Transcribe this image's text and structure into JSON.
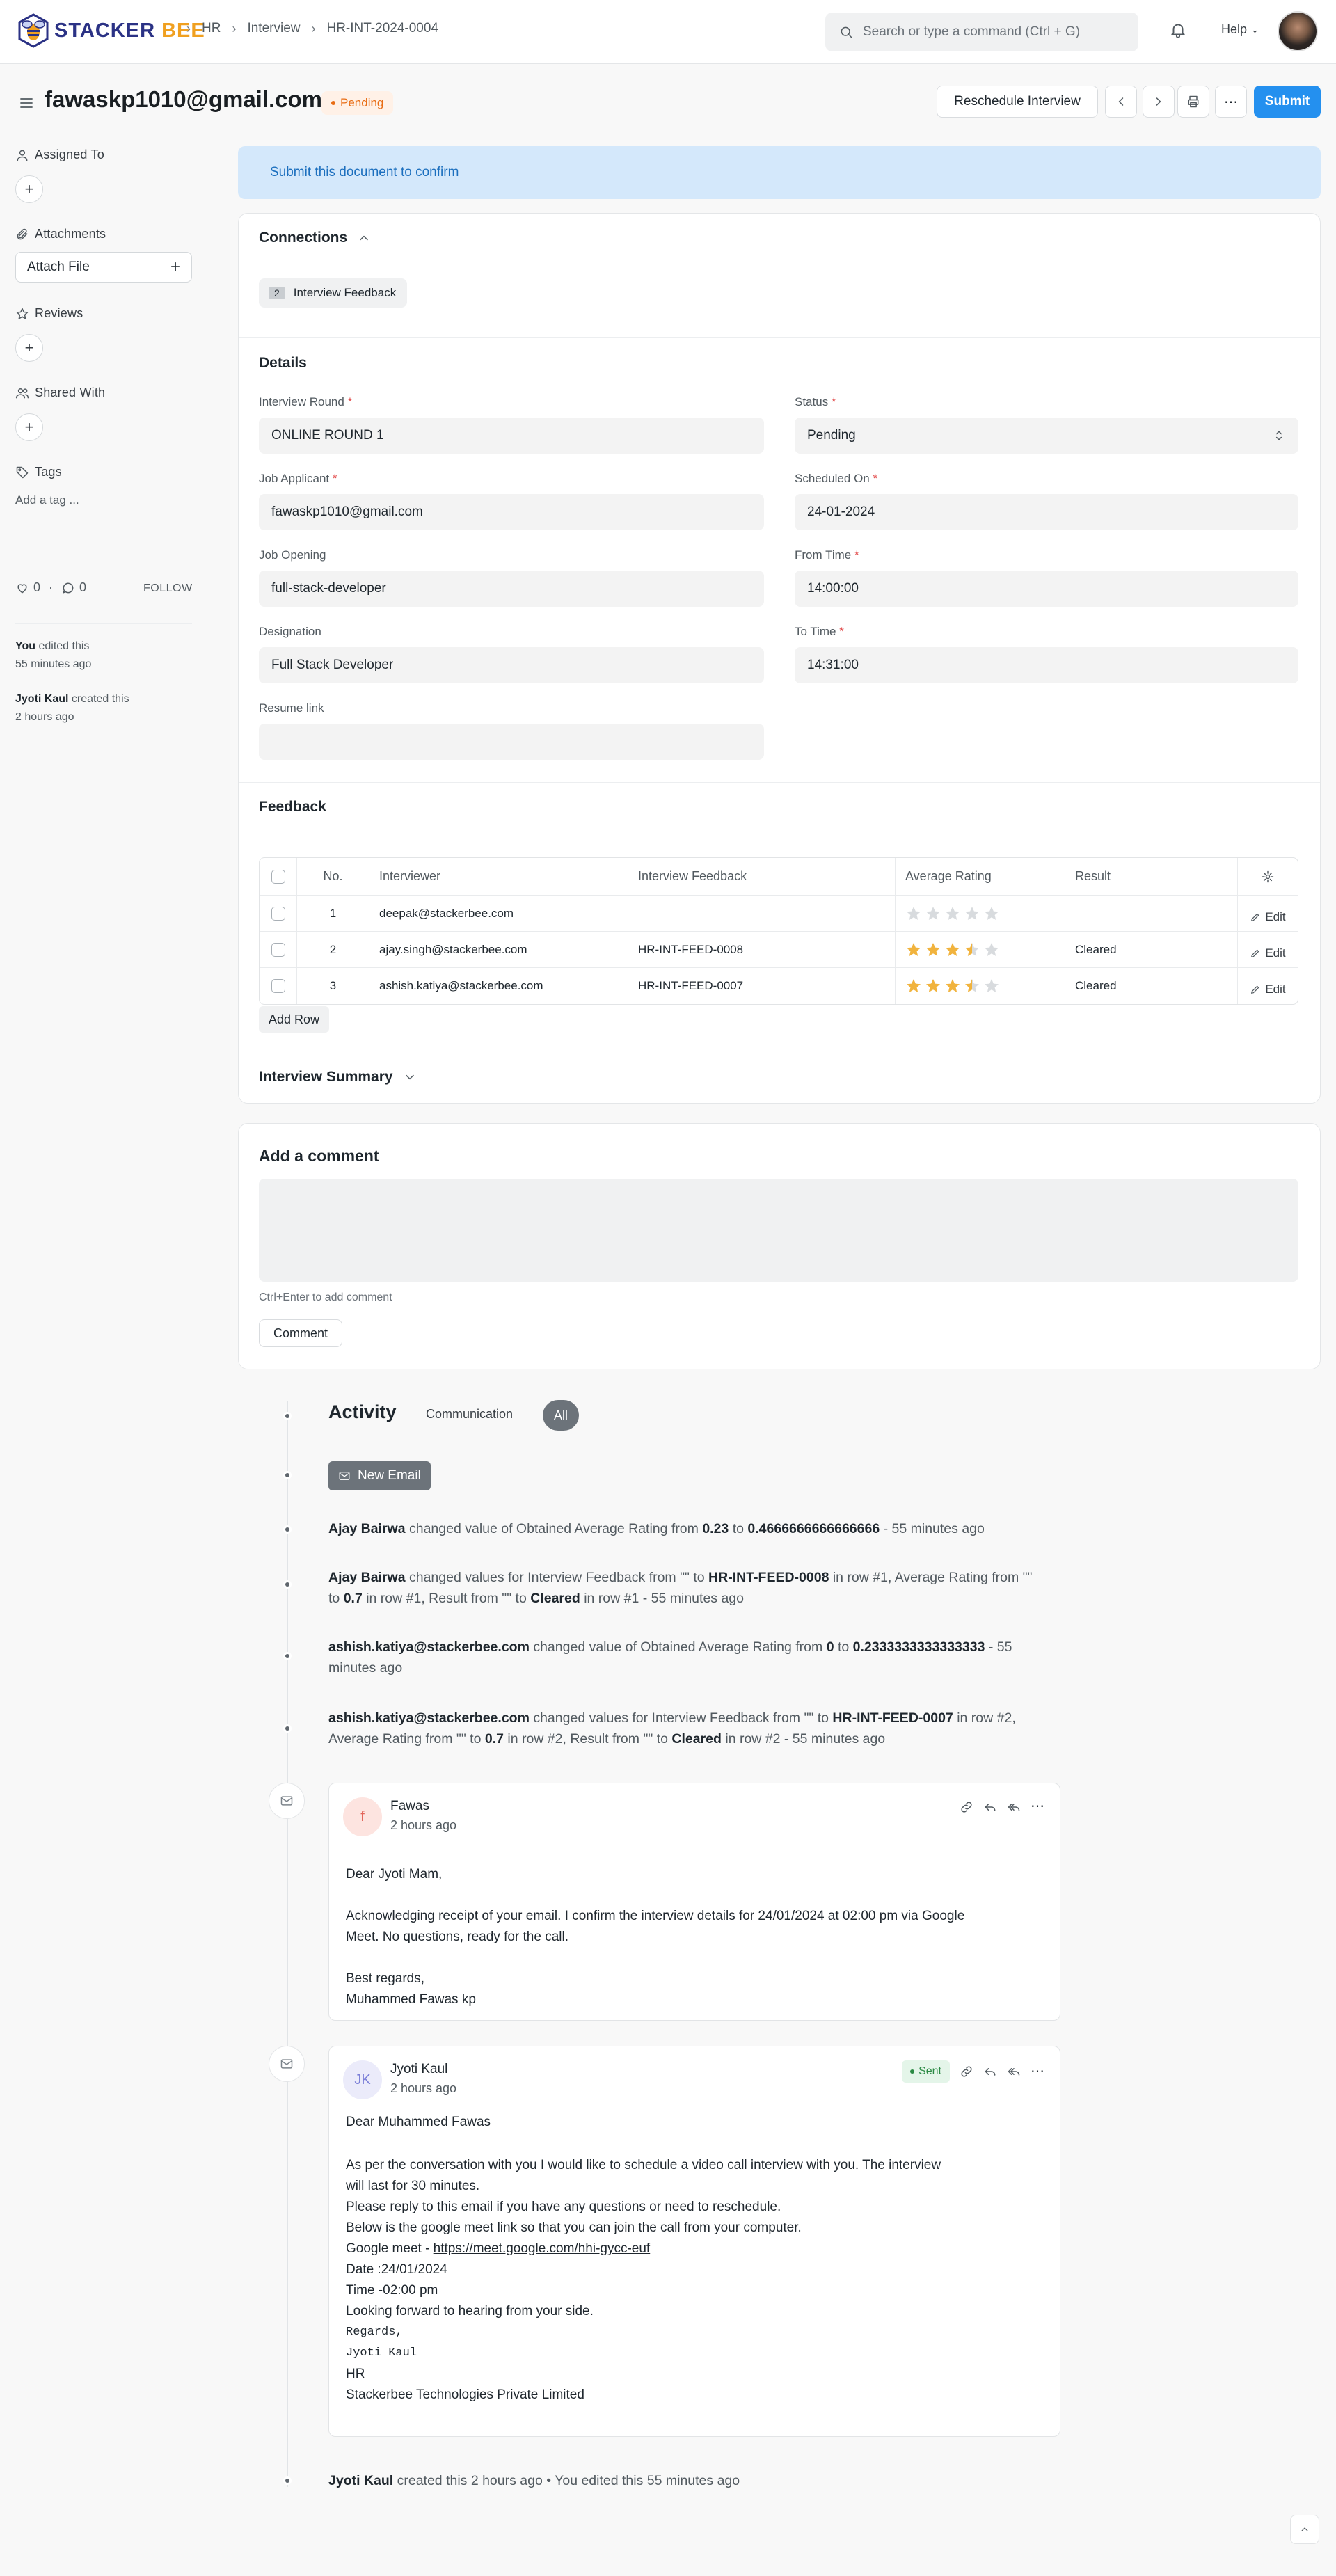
{
  "navbar": {
    "logo_text_1": "STACKER",
    "logo_text_2": "BEE",
    "breadcrumbs": [
      "HR",
      "Interview",
      "HR-INT-2024-0004"
    ],
    "search_placeholder": "Search or type a command (Ctrl + G)",
    "help_label": "Help"
  },
  "page": {
    "title": "fawaskp1010@gmail.com",
    "status_badge": "Pending",
    "reschedule_label": "Reschedule Interview",
    "submit_label": "Submit"
  },
  "sidebar": {
    "assigned_to": "Assigned To",
    "attachments": "Attachments",
    "attach_file": "Attach File",
    "reviews": "Reviews",
    "shared_with": "Shared With",
    "tags": "Tags",
    "add_tag": "Add a tag ...",
    "likes": "0",
    "comments": "0",
    "follow": "FOLLOW",
    "log": [
      {
        "who": "You",
        "text": " edited this",
        "when": "55 minutes ago"
      },
      {
        "who": "Jyoti Kaul",
        "text": " created this",
        "when": "2 hours ago"
      }
    ]
  },
  "banner": "Submit this document to confirm",
  "connections": {
    "title": "Connections",
    "count": "2",
    "label": "Interview Feedback"
  },
  "details": {
    "title": "Details",
    "interview_round_label": "Interview Round",
    "interview_round": "ONLINE ROUND 1",
    "job_applicant_label": "Job Applicant",
    "job_applicant": "fawaskp1010@gmail.com",
    "job_opening_label": "Job Opening",
    "job_opening": "full-stack-developer",
    "designation_label": "Designation",
    "designation": "Full Stack Developer",
    "resume_link_label": "Resume link",
    "resume_link": "",
    "status_label": "Status",
    "status": "Pending",
    "scheduled_on_label": "Scheduled On",
    "scheduled_on": "24-01-2024",
    "from_time_label": "From Time",
    "from_time": "14:00:00",
    "to_time_label": "To Time",
    "to_time": "14:31:00"
  },
  "feedback": {
    "title": "Feedback",
    "columns": [
      "No.",
      "Interviewer",
      "Interview Feedback",
      "Average Rating",
      "Result"
    ],
    "rows": [
      {
        "no": "1",
        "interviewer": "deepak@stackerbee.com",
        "feedback": "",
        "rating": 0,
        "result": ""
      },
      {
        "no": "2",
        "interviewer": "ajay.singh@stackerbee.com",
        "feedback": "HR-INT-FEED-0008",
        "rating": 3.5,
        "result": "Cleared"
      },
      {
        "no": "3",
        "interviewer": "ashish.katiya@stackerbee.com",
        "feedback": "HR-INT-FEED-0007",
        "rating": 3.5,
        "result": "Cleared"
      }
    ],
    "edit_label": "Edit",
    "add_row": "Add Row"
  },
  "summary_title": "Interview Summary",
  "comment": {
    "title": "Add a comment",
    "hint": "Ctrl+Enter to add comment",
    "button": "Comment"
  },
  "activity": {
    "title": "Activity",
    "tab_communication": "Communication",
    "tab_all": "All",
    "new_email": "New Email",
    "items": [
      {
        "actor": "Ajay Bairwa",
        "t1": " changed value of Obtained Average Rating from ",
        "v1": "0.23",
        "t2": " to ",
        "v2": "0.4666666666666666",
        "t3": " - 55 minutes ago"
      },
      {
        "actor": "Ajay Bairwa",
        "t1": " changed values for Interview Feedback from \"\" to ",
        "v1": "HR-INT-FEED-0008",
        "t2": " in row #1, Average Rating from \"\" to ",
        "v2": "0.7",
        "t3": " in row #1, Result from \"\" to ",
        "v3": "Cleared",
        "t4": " in row #1 - 55 minutes ago"
      },
      {
        "actor": "ashish.katiya@stackerbee.com",
        "t1": " changed value of Obtained Average Rating from ",
        "v1": "0",
        "t2": " to ",
        "v2": "0.2333333333333333",
        "t3": " - 55 minutes ago"
      },
      {
        "actor": "ashish.katiya@stackerbee.com",
        "t1": " changed values for Interview Feedback from \"\" to ",
        "v1": "HR-INT-FEED-0007",
        "t2": " in row #2, Average Rating from \"\" to ",
        "v2": "0.7",
        "t3": " in row #2, Result from \"\" to ",
        "v3": "Cleared",
        "t4": " in row #2 - 55 minutes ago"
      }
    ],
    "footer_actor": "Jyoti Kaul",
    "footer_text": " created this 2 hours ago • You edited this 55 minutes ago"
  },
  "email1": {
    "initial": "f",
    "sender": "Fawas",
    "time": "2 hours ago",
    "lines": [
      "Dear Jyoti Mam,",
      "",
      "Acknowledging receipt of your email. I confirm the interview details for 24/01/2024 at 02:00 pm via Google",
      "Meet. No questions, ready for the call.",
      "",
      "Best regards,",
      "Muhammed Fawas kp"
    ]
  },
  "email2": {
    "initial": "JK",
    "sender": "Jyoti Kaul",
    "time": "2 hours ago",
    "sent_badge": "Sent",
    "greeting": "Dear Muhammed Fawas",
    "lines": [
      "As per the conversation with you I would like to schedule a video call interview with you. The interview",
      "will last for 30 minutes.",
      "Please reply to this email if you have any questions or need to reschedule.",
      "Below is the google meet link so that you can join the call from your computer."
    ],
    "meet_prefix": "Google meet - ",
    "meet_link": "https://meet.google.com/hhi-gycc-euf",
    "date_line": "Date :24/01/2024",
    "time_line": "Time -02:00 pm",
    "closing": "Looking forward to hearing from your side.",
    "sig1": "Regards,",
    "sig2": "Jyoti Kaul",
    "sig3": "HR",
    "sig4": "Stackerbee Technologies Private Limited"
  },
  "colors": {
    "primary": "#2490ef",
    "pending": "#e86c13",
    "star": "#f1b33d",
    "star_empty": "#d8dbde"
  }
}
